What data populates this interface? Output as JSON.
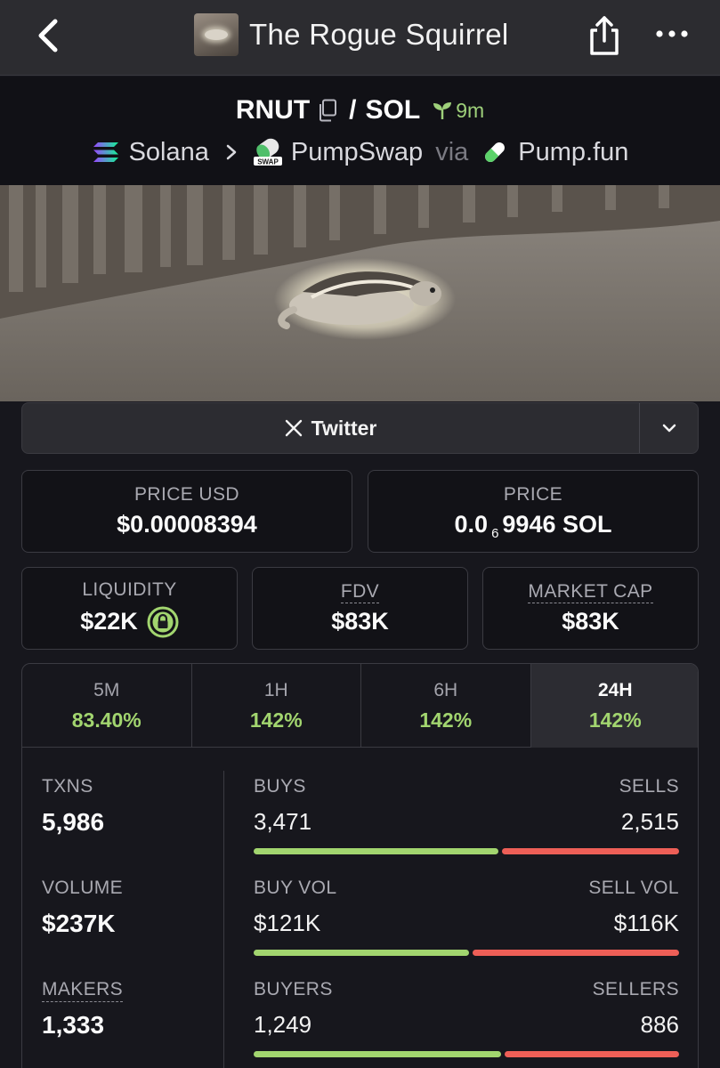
{
  "header": {
    "title": "The Rogue Squirrel"
  },
  "pair": {
    "base": "RNUT",
    "separator": "/",
    "quote": "SOL",
    "age": "9m",
    "chain": "Solana",
    "dex": "PumpSwap",
    "via": "via",
    "launchpad": "Pump.fun",
    "dex_icon_text": "SWAP"
  },
  "links": {
    "twitter_label": "Twitter"
  },
  "prices": {
    "price_usd_label": "PRICE USD",
    "price_usd": "$0.00008394",
    "price_label": "PRICE",
    "price_prefix": "0.0",
    "price_zeros": "6",
    "price_suffix": "9946 SOL"
  },
  "metrics": {
    "liquidity_label": "LIQUIDITY",
    "liquidity": "$22K",
    "fdv_label": "FDV",
    "fdv": "$83K",
    "mcap_label": "MARKET CAP",
    "mcap": "$83K"
  },
  "timeframes": [
    {
      "label": "5M",
      "change": "83.40%"
    },
    {
      "label": "1H",
      "change": "142%"
    },
    {
      "label": "6H",
      "change": "142%"
    },
    {
      "label": "24H",
      "change": "142%"
    }
  ],
  "active_timeframe": "24H",
  "activity": {
    "txns_label": "TXNS",
    "txns": "5,986",
    "volume_label": "VOLUME",
    "volume": "$237K",
    "makers_label": "MAKERS",
    "makers": "1,333",
    "buys_label": "BUYS",
    "buys": "3,471",
    "sells_label": "SELLS",
    "sells": "2,515",
    "buy_vol_label": "BUY VOL",
    "buy_vol": "$121K",
    "sell_vol_label": "SELL VOL",
    "sell_vol": "$116K",
    "buyers_label": "BUYERS",
    "buyers": "1,249",
    "sellers_label": "SELLERS",
    "sellers": "886",
    "buys_ratio": 0.58,
    "buy_vol_ratio": 0.51,
    "buyers_ratio": 0.585
  },
  "colors": {
    "positive": "#a2d56f",
    "negative": "#ee5f57",
    "background": "#17171d"
  },
  "icons": [
    "back-arrow-icon",
    "share-icon",
    "more-icon",
    "copy-icon",
    "sprout-icon",
    "solana-icon",
    "chevron-right-icon",
    "pumpswap-icon",
    "pill-icon",
    "x-icon",
    "chevron-down-icon",
    "lock-icon"
  ]
}
